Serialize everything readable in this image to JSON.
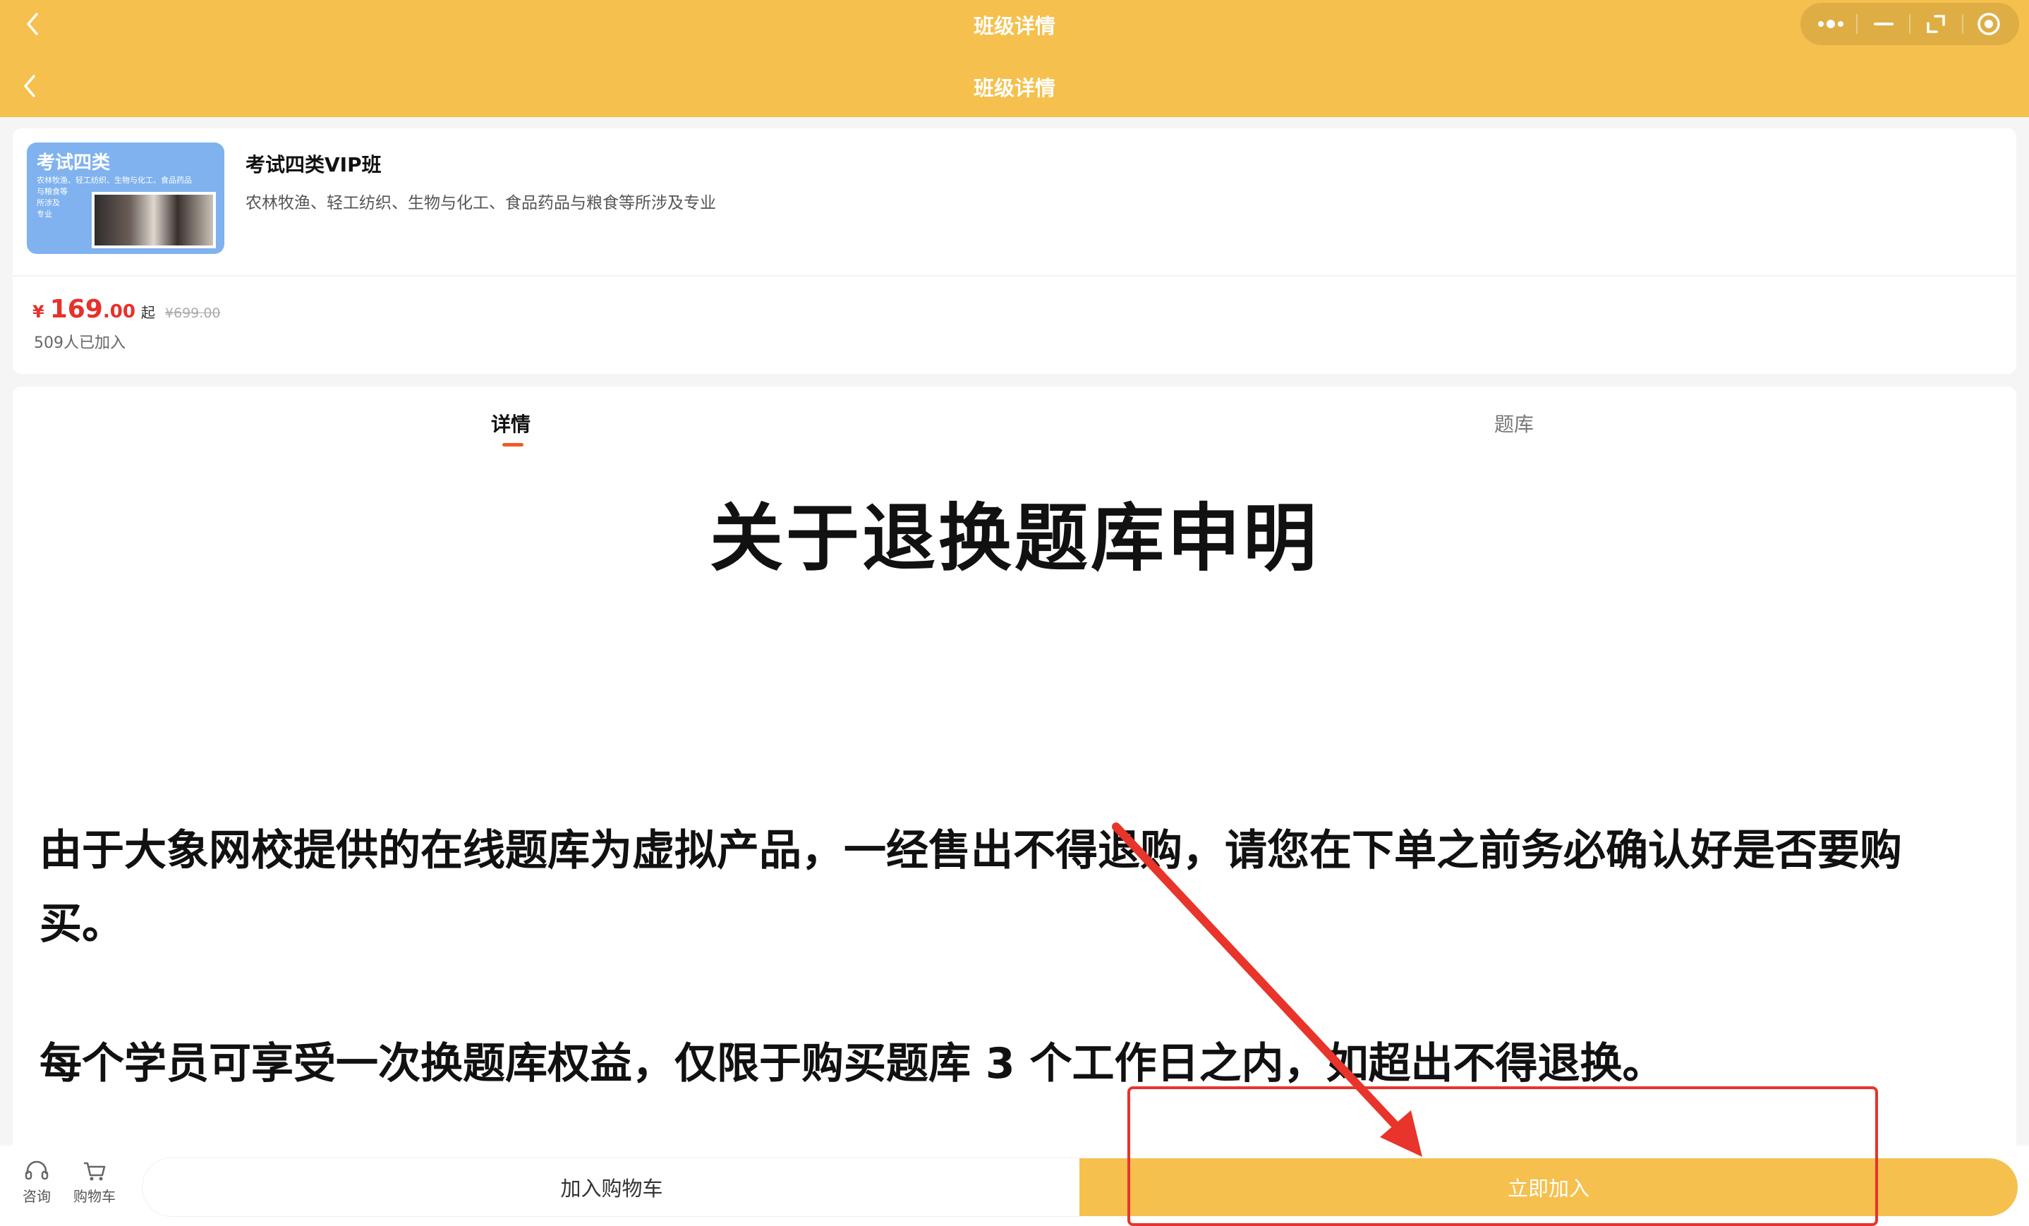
{
  "topbar": {
    "title": "班级详情",
    "capsule_icons": [
      "more-icon",
      "minimize-icon",
      "restore-icon",
      "record-icon"
    ]
  },
  "navbar": {
    "title": "班级详情"
  },
  "course": {
    "thumbnail": {
      "title": "考试四类",
      "lines": [
        "农林牧渔、轻工纺织、生物与化工、食品药品",
        "与粮食等",
        "所涉及",
        "专业"
      ]
    },
    "name": "考试四类VIP班",
    "description": "农林牧渔、轻工纺织、生物与化工、食品药品与粮食等所涉及专业",
    "price": {
      "symbol": "¥",
      "integer": "169",
      "decimal": ".00",
      "suffix": "起",
      "original": "¥699.00"
    },
    "joined": "509人已加入"
  },
  "tabs": {
    "detail": "详情",
    "bank": "题库",
    "active": "detail"
  },
  "article": {
    "title": "关于退换题库申明",
    "paragraph1": "由于大象网校提供的在线题库为虚拟产品，一经售出不得退购，请您在下单之前务必确认好是否要购买。",
    "paragraph2": "每个学员可享受一次换题库权益，仅限于购买题库 3 个工作日之内，如超出不得退换。"
  },
  "bottom": {
    "consult_label": "咨询",
    "cart_label": "购物车",
    "add_to_cart": "加入购物车",
    "join_now": "立即加入"
  },
  "colors": {
    "brand": "#f5c04d",
    "price": "#e8302a",
    "tab_accent": "#f05a28",
    "annotation": "#e8342a"
  }
}
